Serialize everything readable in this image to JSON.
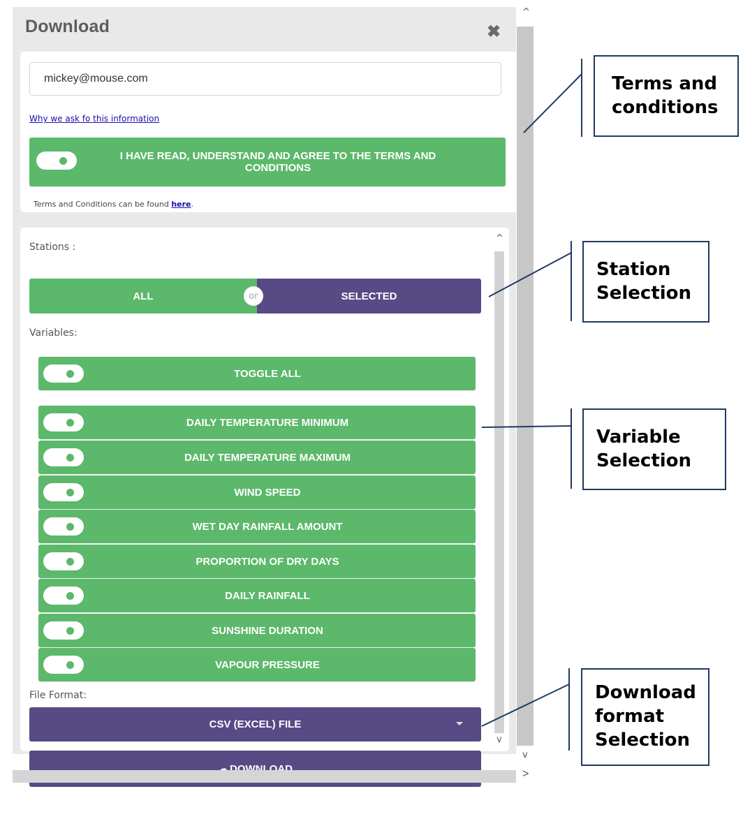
{
  "panel": {
    "title": "Download",
    "close_glyph": "✖"
  },
  "terms": {
    "email_value": "mickey@mouse.com",
    "why_link": "Why we ask fo this information",
    "agree_label": "I HAVE READ, UNDERSTAND AND AGREE TO THE TERMS AND CONDITIONS",
    "note_prefix": "Terms and Conditions can be found ",
    "note_link": "here",
    "note_suffix": "."
  },
  "stations": {
    "label": "Stations :",
    "all": "ALL",
    "or": "or",
    "selected": "SELECTED"
  },
  "variables": {
    "label": "Variables:",
    "toggle_all": "TOGGLE ALL",
    "items": [
      "DAILY TEMPERATURE MINIMUM",
      "DAILY TEMPERATURE MAXIMUM",
      "WIND SPEED",
      "WET DAY RAINFALL AMOUNT",
      "PROPORTION OF DRY DAYS",
      "DAILY RAINFALL",
      "SUNSHINE DURATION",
      "VAPOUR PRESSURE"
    ]
  },
  "format": {
    "label": "File Format:",
    "selected": "CSV (EXCEL) FILE"
  },
  "download": {
    "icon_glyph": "☁",
    "label": "DOWNLOAD"
  },
  "scroll": {
    "up": "^",
    "down": "v",
    "right": ">"
  },
  "callouts": {
    "terms": [
      "Terms and",
      "conditions"
    ],
    "station": [
      "Station",
      "Selection"
    ],
    "variable": [
      "Variable",
      "Selection"
    ],
    "download": [
      "Download",
      "format",
      "Selection"
    ]
  },
  "colors": {
    "green": "#5cb86b",
    "purple": "#574a85",
    "callout_line": "#1f3a5f"
  }
}
